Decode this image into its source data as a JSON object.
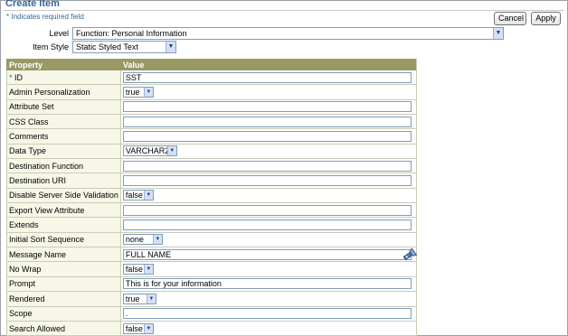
{
  "page": {
    "title": "Create Item",
    "required_note": "Indicates required field",
    "required_marker": "*"
  },
  "buttons": {
    "cancel": "Cancel",
    "apply": "Apply"
  },
  "form": {
    "level_label": "Level",
    "level_value": "Function: Personal Information",
    "item_style_label": "Item Style",
    "item_style_value": "Static Styled Text"
  },
  "table": {
    "headers": {
      "property": "Property",
      "value": "Value"
    },
    "rows": [
      {
        "label": "ID",
        "required": true,
        "type": "text",
        "value": "SST"
      },
      {
        "label": "Admin Personalization",
        "type": "select",
        "value": "true"
      },
      {
        "label": "Attribute Set",
        "type": "text",
        "value": ""
      },
      {
        "label": "CSS Class",
        "type": "text",
        "value": ""
      },
      {
        "label": "Comments",
        "type": "text",
        "value": ""
      },
      {
        "label": "Data Type",
        "type": "select",
        "value": "VARCHAR2"
      },
      {
        "label": "Destination Function",
        "type": "text",
        "value": ""
      },
      {
        "label": "Destination URI",
        "type": "text",
        "value": ""
      },
      {
        "label": "Disable Server Side Validation",
        "type": "select",
        "value": "false"
      },
      {
        "label": "Export View Attribute",
        "type": "text",
        "value": ""
      },
      {
        "label": "Extends",
        "type": "text",
        "value": ""
      },
      {
        "label": "Initial Sort Sequence",
        "type": "select",
        "value": "none"
      },
      {
        "label": "Message Name",
        "type": "text",
        "value": "FULL NAME"
      },
      {
        "label": "No Wrap",
        "type": "select",
        "value": "false"
      },
      {
        "label": "Prompt",
        "type": "text",
        "value": "This is for your information"
      },
      {
        "label": "Rendered",
        "type": "select",
        "value": "true"
      },
      {
        "label": "Scope",
        "type": "text",
        "value": "."
      },
      {
        "label": "Search Allowed",
        "type": "select",
        "value": "false"
      }
    ]
  },
  "colors": {
    "title": "#336699",
    "header_bg": "#999966",
    "prop_bg": "#f7f7e7"
  },
  "icons": {
    "message_lookup": "flashlight-icon",
    "dropdown": "chevron-down-icon"
  }
}
